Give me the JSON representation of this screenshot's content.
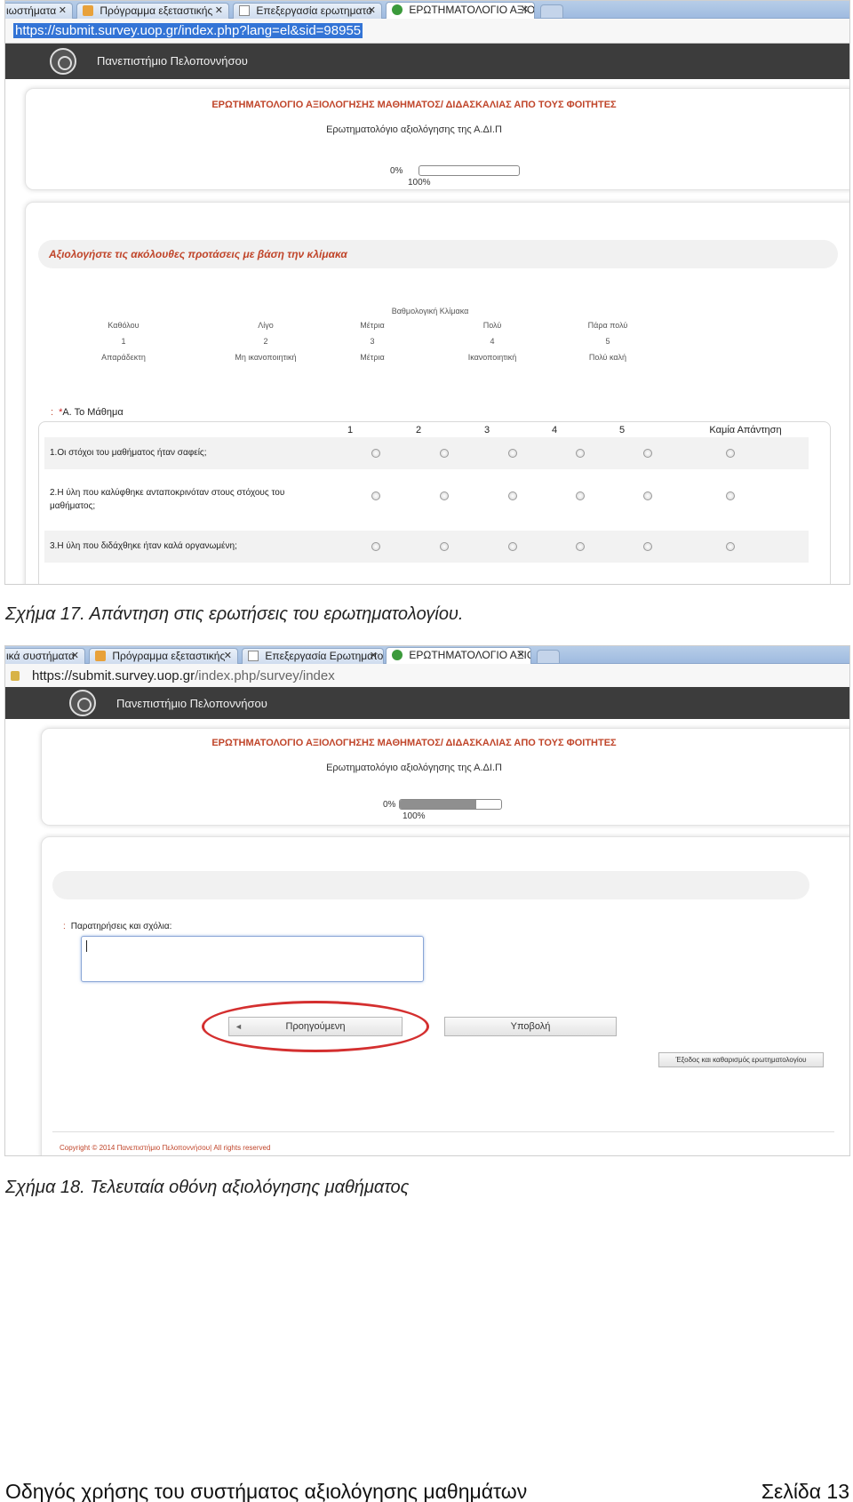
{
  "figure17": {
    "tabs": [
      {
        "label": "ιωστήματα",
        "icon": "none"
      },
      {
        "label": "Πρόγραμμα εξεταστικής",
        "icon": "home-icon"
      },
      {
        "label": "Επεξεργασία ερωτηματο",
        "icon": "doc-icon"
      },
      {
        "label": "ΕΡΩΤΗΜΑΤΟΛΟΓΙΟ ΑΞΙΟ",
        "icon": "check-icon"
      }
    ],
    "url": "https://submit.survey.uop.gr/index.php?lang=el&sid=98955",
    "university": "Πανεπιστήμιο Πελοποννήσου",
    "survey_title": "ΕΡΩΤΗΜΑΤΟΛΟΓΙΟ ΑΞΙΟΛΟΓΗΣΗΣ ΜΑΘΗΜΑΤΟΣ/ ΔΙΔΑΣΚΑΛΙΑΣ ΑΠΟ ΤΟΥΣ ΦΟΙΤΗΤΕΣ",
    "survey_subtitle": "Ερωτηματολόγιο αξιολόγησης της Α.ΔΙ.Π",
    "progress": {
      "start": "0%",
      "end": "100%",
      "fraction": 0
    },
    "section_heading": "Αξιολογήστε τις ακόλουθες προτάσεις με βάση την κλίμακα",
    "scale": {
      "title": "Βαθμολογική Κλίμακα",
      "columns": [
        {
          "word": "Καθόλου",
          "num": "1",
          "desc": "Απαράδεκτη"
        },
        {
          "word": "Λίγο",
          "num": "2",
          "desc": "Μη ικανοποιητική"
        },
        {
          "word": "Μέτρια",
          "num": "3",
          "desc": "Μέτρια"
        },
        {
          "word": "Πολύ",
          "num": "4",
          "desc": "Ικανοποιητική"
        },
        {
          "word": "Πάρα πολύ",
          "num": "5",
          "desc": "Πολύ καλή"
        }
      ]
    },
    "group": {
      "colon": ":",
      "star": "*",
      "label": "Α. Το Μάθημα"
    },
    "grid_headers": [
      "1",
      "2",
      "3",
      "4",
      "5",
      "Καμία Απάντηση"
    ],
    "questions": [
      "1.Οι στόχοι του μαθήματος ήταν σαφείς;",
      "2.Η ύλη που καλύφθηκε ανταποκρινόταν στους στόχους του μαθήματος;",
      "3.Η ύλη που διδάχθηκε ήταν καλά οργανωμένη;"
    ],
    "caption": "Σχήμα 17. Απάντηση στις ερωτήσεις του ερωτηματολογίου."
  },
  "figure18": {
    "tabs": [
      {
        "label": "ικά συστήματα",
        "icon": "none"
      },
      {
        "label": "Πρόγραμμα εξεταστικής",
        "icon": "home-icon"
      },
      {
        "label": "Επεξεργασία Ερωτηματο",
        "icon": "doc-icon"
      },
      {
        "label": "ΕΡΩΤΗΜΑΤΟΛΟΓΙΟ ΑΞΙΟ",
        "icon": "check-icon"
      }
    ],
    "url_host": "https://submit.survey.uop.gr",
    "url_path": "/index.php/survey/index",
    "university": "Πανεπιστήμιο Πελοποννήσου",
    "survey_title": "ΕΡΩΤΗΜΑΤΟΛΟΓΙΟ ΑΞΙΟΛΟΓΗΣΗΣ ΜΑΘΗΜΑΤΟΣ/ ΔΙΔΑΣΚΑΛΙΑΣ ΑΠΟ ΤΟΥΣ ΦΟΙΤΗΤΕΣ",
    "survey_subtitle": "Ερωτηματολόγιο αξιολόγησης της Α.ΔΙ.Π",
    "progress": {
      "start": "0%",
      "end": "100%",
      "fraction": 0.75
    },
    "comment_label": "Παρατηρήσεις και σχόλια:",
    "comment_colon": ":",
    "comment_value": "",
    "buttons": {
      "previous": "Προηγούμενη",
      "submit": "Υποβολή",
      "exit": "Έξοδος και καθαρισμός ερωτηματολογίου"
    },
    "copyright": "Copyright © 2014 Πανεπιστήμιο Πελοποννήσου| All rights reserved",
    "caption": "Σχήμα 18. Τελευταία οθόνη αξιολόγησης μαθήματος"
  },
  "footer": {
    "left": "Οδηγός χρήσης του συστήματος αξιολόγησης μαθημάτων",
    "right": "Σελίδα 13"
  },
  "colors": {
    "accent": "#c0452a",
    "header": "#3c3c3c",
    "annotation_ring": "#d42f2f",
    "url_highlight": "#3374d6"
  }
}
